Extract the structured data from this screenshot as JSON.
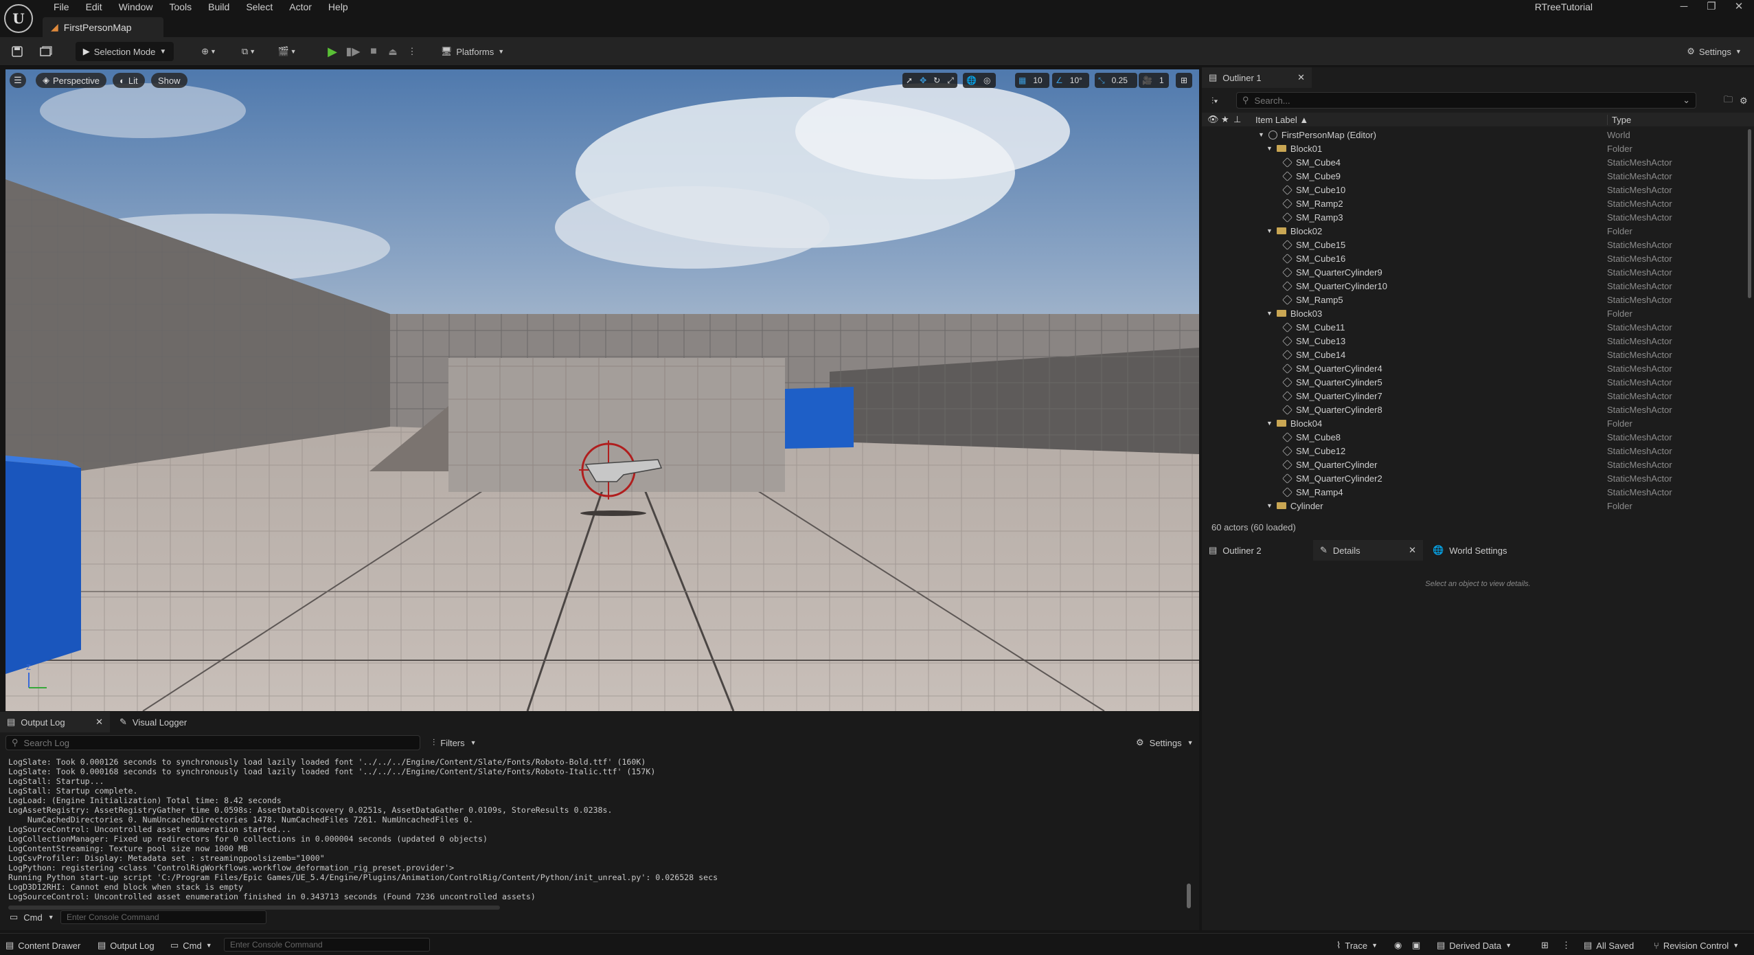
{
  "app": {
    "project_name": "RTreeTutorial",
    "menu": [
      "File",
      "Edit",
      "Window",
      "Tools",
      "Build",
      "Select",
      "Actor",
      "Help"
    ],
    "map_tab": "FirstPersonMap"
  },
  "toolbar": {
    "selection_mode": "Selection Mode",
    "platforms": "Platforms",
    "settings": "Settings"
  },
  "viewport": {
    "perspective": "Perspective",
    "lit": "Lit",
    "show": "Show",
    "grid_snap": "10",
    "rotation_snap": "10°",
    "scale_snap": "0.25",
    "camera_speed": "1"
  },
  "outliner": {
    "tab": "Outliner 1",
    "search_placeholder": "Search...",
    "col_label": "Item Label ▲",
    "col_type": "Type",
    "actor_count": "60 actors (60 loaded)",
    "items": [
      {
        "label": "FirstPersonMap (Editor)",
        "type": "World",
        "depth": 0,
        "icon": "world-icon"
      },
      {
        "label": "Block01",
        "type": "Folder",
        "depth": 1,
        "icon": "folder-icon"
      },
      {
        "label": "SM_Cube4",
        "type": "StaticMeshActor",
        "depth": 2,
        "icon": "mesh-icon"
      },
      {
        "label": "SM_Cube9",
        "type": "StaticMeshActor",
        "depth": 2,
        "icon": "mesh-icon"
      },
      {
        "label": "SM_Cube10",
        "type": "StaticMeshActor",
        "depth": 2,
        "icon": "mesh-icon"
      },
      {
        "label": "SM_Ramp2",
        "type": "StaticMeshActor",
        "depth": 2,
        "icon": "mesh-icon"
      },
      {
        "label": "SM_Ramp3",
        "type": "StaticMeshActor",
        "depth": 2,
        "icon": "mesh-icon"
      },
      {
        "label": "Block02",
        "type": "Folder",
        "depth": 1,
        "icon": "folder-icon"
      },
      {
        "label": "SM_Cube15",
        "type": "StaticMeshActor",
        "depth": 2,
        "icon": "mesh-icon"
      },
      {
        "label": "SM_Cube16",
        "type": "StaticMeshActor",
        "depth": 2,
        "icon": "mesh-icon"
      },
      {
        "label": "SM_QuarterCylinder9",
        "type": "StaticMeshActor",
        "depth": 2,
        "icon": "mesh-icon"
      },
      {
        "label": "SM_QuarterCylinder10",
        "type": "StaticMeshActor",
        "depth": 2,
        "icon": "mesh-icon"
      },
      {
        "label": "SM_Ramp5",
        "type": "StaticMeshActor",
        "depth": 2,
        "icon": "mesh-icon"
      },
      {
        "label": "Block03",
        "type": "Folder",
        "depth": 1,
        "icon": "folder-icon"
      },
      {
        "label": "SM_Cube11",
        "type": "StaticMeshActor",
        "depth": 2,
        "icon": "mesh-icon"
      },
      {
        "label": "SM_Cube13",
        "type": "StaticMeshActor",
        "depth": 2,
        "icon": "mesh-icon"
      },
      {
        "label": "SM_Cube14",
        "type": "StaticMeshActor",
        "depth": 2,
        "icon": "mesh-icon"
      },
      {
        "label": "SM_QuarterCylinder4",
        "type": "StaticMeshActor",
        "depth": 2,
        "icon": "mesh-icon"
      },
      {
        "label": "SM_QuarterCylinder5",
        "type": "StaticMeshActor",
        "depth": 2,
        "icon": "mesh-icon"
      },
      {
        "label": "SM_QuarterCylinder7",
        "type": "StaticMeshActor",
        "depth": 2,
        "icon": "mesh-icon"
      },
      {
        "label": "SM_QuarterCylinder8",
        "type": "StaticMeshActor",
        "depth": 2,
        "icon": "mesh-icon"
      },
      {
        "label": "Block04",
        "type": "Folder",
        "depth": 1,
        "icon": "folder-icon"
      },
      {
        "label": "SM_Cube8",
        "type": "StaticMeshActor",
        "depth": 2,
        "icon": "mesh-icon"
      },
      {
        "label": "SM_Cube12",
        "type": "StaticMeshActor",
        "depth": 2,
        "icon": "mesh-icon"
      },
      {
        "label": "SM_QuarterCylinder",
        "type": "StaticMeshActor",
        "depth": 2,
        "icon": "mesh-icon"
      },
      {
        "label": "SM_QuarterCylinder2",
        "type": "StaticMeshActor",
        "depth": 2,
        "icon": "mesh-icon"
      },
      {
        "label": "SM_Ramp4",
        "type": "StaticMeshActor",
        "depth": 2,
        "icon": "mesh-icon"
      },
      {
        "label": "Cylinder",
        "type": "Folder",
        "depth": 1,
        "icon": "folder-icon"
      }
    ]
  },
  "details": {
    "tabs": [
      "Outliner 2",
      "Details",
      "World Settings"
    ],
    "hint": "Select an object to view details."
  },
  "output_log": {
    "tabs": [
      "Output Log",
      "Visual Logger"
    ],
    "search_placeholder": "Search Log",
    "filters": "Filters",
    "settings": "Settings",
    "lines": [
      "LogSlate: Took 0.000126 seconds to synchronously load lazily loaded font '../../../Engine/Content/Slate/Fonts/Roboto-Bold.ttf' (160K)",
      "LogSlate: Took 0.000168 seconds to synchronously load lazily loaded font '../../../Engine/Content/Slate/Fonts/Roboto-Italic.ttf' (157K)",
      "LogStall: Startup...",
      "LogStall: Startup complete.",
      "LogLoad: (Engine Initialization) Total time: 8.42 seconds",
      "LogAssetRegistry: AssetRegistryGather time 0.0598s: AssetDataDiscovery 0.0251s, AssetDataGather 0.0109s, StoreResults 0.0238s.",
      "    NumCachedDirectories 0. NumUncachedDirectories 1478. NumCachedFiles 7261. NumUncachedFiles 0.",
      "LogSourceControl: Uncontrolled asset enumeration started...",
      "LogCollectionManager: Fixed up redirectors for 0 collections in 0.000004 seconds (updated 0 objects)",
      "LogContentStreaming: Texture pool size now 1000 MB",
      "LogCsvProfiler: Display: Metadata set : streamingpoolsizemb=\"1000\"",
      "LogPython: registering <class 'ControlRigWorkflows.workflow_deformation_rig_preset.provider'>",
      "Running Python start-up script 'C:/Program Files/Epic Games/UE_5.4/Engine/Plugins/Animation/ControlRig/Content/Python/init_unreal.py': 0.026528 secs",
      "LogD3D12RHI: Cannot end block when stack is empty",
      "LogSourceControl: Uncontrolled asset enumeration finished in 0.343713 seconds (Found 7236 uncontrolled assets)"
    ],
    "cmd_label": "Cmd",
    "cmd_placeholder": "Enter Console Command"
  },
  "statusbar": {
    "content_drawer": "Content Drawer",
    "output_log": "Output Log",
    "cmd": "Cmd",
    "cmd_placeholder": "Enter Console Command",
    "trace": "Trace",
    "derived_data": "Derived Data",
    "all_saved": "All Saved",
    "revision_control": "Revision Control"
  }
}
